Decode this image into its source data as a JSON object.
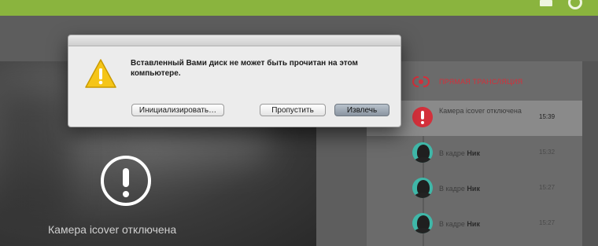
{
  "dialog": {
    "message": "Вставленный Вами диск не может быть прочитан на этом компьютере.",
    "buttons": {
      "initialize": "Инициализировать…",
      "skip": "Пропустить",
      "eject": "Извлечь"
    }
  },
  "video": {
    "caption": "Камера icover отключена"
  },
  "panel": {
    "live_label": "ПРЯМАЯ ТРАНСЛЯЦИЯ",
    "feed": [
      {
        "text": "Камера icover отключена",
        "time": "15:39",
        "icon": "alert-icon"
      },
      {
        "text_prefix": "В кадре ",
        "name": "Ник",
        "time": "15:32",
        "icon": "face-avatar"
      },
      {
        "text_prefix": "В кадре ",
        "name": "Ник",
        "time": "15:27",
        "icon": "face-avatar"
      },
      {
        "text_prefix": "В кадре ",
        "name": "Ник",
        "time": "15:27",
        "icon": "face-avatar"
      }
    ]
  },
  "colors": {
    "topbar": "#8ab43e",
    "live_red": "#d3303b",
    "avatar_teal": "#3fb7a8"
  }
}
